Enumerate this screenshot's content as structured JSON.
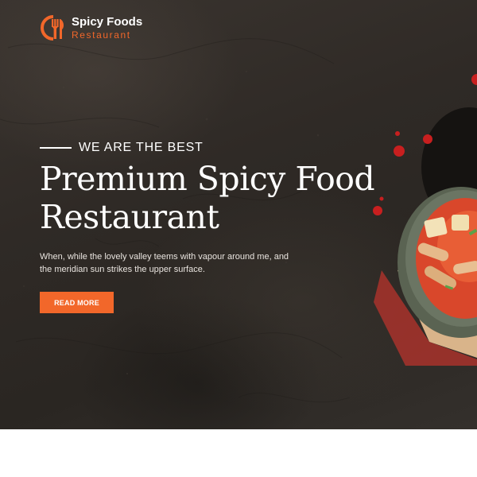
{
  "brand": {
    "title": "Spicy Foods",
    "subtitle": "Restaurant",
    "logo_icon": "fork-knife-plate-icon",
    "accent_color": "#f2672a"
  },
  "hero": {
    "tagline": "WE ARE THE BEST",
    "headline_line1": "Premium Spicy Food",
    "headline_line2": "Restaurant",
    "description_line1": "When, while the lovely valley teems with vapour around me, and",
    "description_line2": "the meridian sun strikes the upper surface.",
    "cta_label": "READ MORE",
    "image": "spicy-stew-bowl-image"
  }
}
